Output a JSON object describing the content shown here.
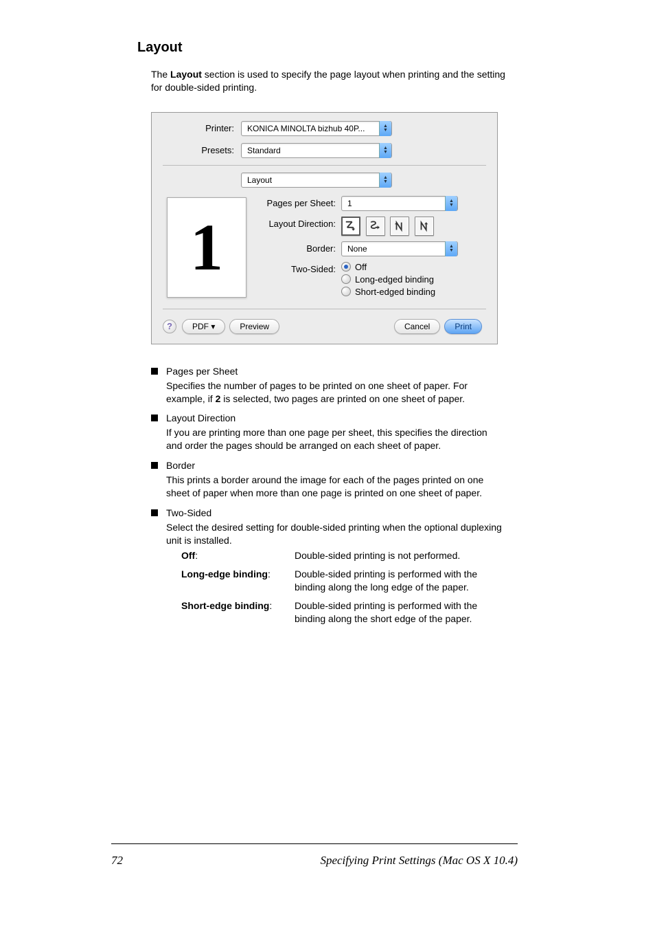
{
  "section": {
    "title": "Layout"
  },
  "intro": {
    "text_a": "The ",
    "text_b": "Layout",
    "text_c": " section is used to specify the page layout when printing and the setting for double-sided printing."
  },
  "dialog": {
    "printer_label": "Printer:",
    "printer_value": "KONICA MINOLTA bizhub 40P...",
    "presets_label": "Presets:",
    "presets_value": "Standard",
    "pane_value": "Layout",
    "preview_page": "1",
    "pps_label": "Pages per Sheet:",
    "pps_value": "1",
    "dir_label": "Layout Direction:",
    "border_label": "Border:",
    "border_value": "None",
    "twosided_label": "Two-Sided:",
    "twosided_off": "Off",
    "twosided_long": "Long-edged binding",
    "twosided_short": "Short-edged binding",
    "help": "?",
    "pdf": "PDF ▾",
    "preview": "Preview",
    "cancel": "Cancel",
    "print": "Print"
  },
  "bullets": {
    "pps": {
      "title": "Pages per Sheet",
      "body_a": "Specifies the number of pages to be printed on one sheet of paper. For example, if ",
      "body_b": "2",
      "body_c": " is selected, two pages are printed on one sheet of paper."
    },
    "dir": {
      "title": "Layout Direction",
      "body": "If you are printing more than one page per sheet, this specifies the direction and order the pages should be arranged on each sheet of paper."
    },
    "border": {
      "title": "Border",
      "body": "This prints a border around the image for each of the pages printed on one sheet of paper when more than one page is printed on one sheet of paper."
    },
    "twosided": {
      "title": "Two-Sided",
      "body": "Select the desired setting for double-sided printing when the optional duplexing unit is installed."
    }
  },
  "defs": {
    "off_key": "Off",
    "off_colon": ":",
    "off_val": "Double-sided printing is not performed.",
    "long_key": "Long-edge binding",
    "long_colon": ":",
    "long_val": "Double-sided printing is performed with the binding along the long edge of the paper.",
    "short_key": "Short-edge binding",
    "short_colon": ":",
    "short_val": "Double-sided printing is performed with the binding along the short edge of the paper."
  },
  "footer": {
    "page_num": "72",
    "title": "Specifying Print Settings (Mac OS X 10.4)"
  }
}
